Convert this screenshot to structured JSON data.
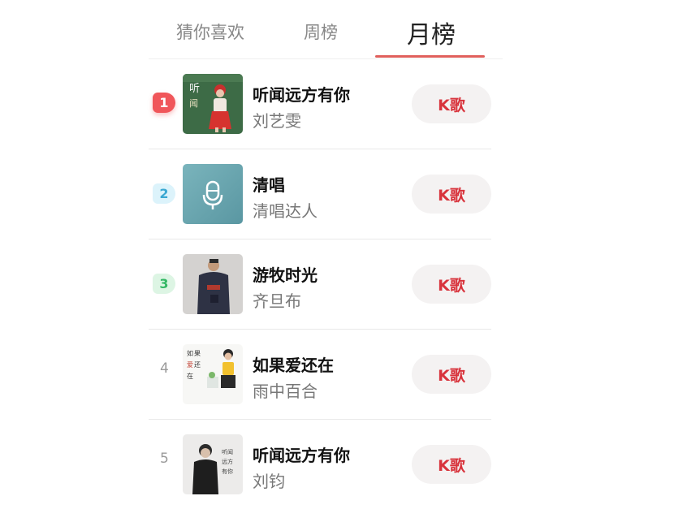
{
  "tabs": [
    {
      "label": "猜你喜欢",
      "active": false
    },
    {
      "label": "周榜",
      "active": false
    },
    {
      "label": "月榜",
      "active": true
    }
  ],
  "colors": {
    "accent": "#e0605c",
    "button_text": "#d8333c",
    "button_bg": "#f4f2f2",
    "rank1_bg": "#f0565a",
    "rank2_bg": "#dcf3fb",
    "rank2_text": "#3aa8d2",
    "rank3_bg": "#ddf5e4",
    "rank3_text": "#35b866"
  },
  "songs": [
    {
      "rank": "1",
      "title": "听闻远方有你",
      "artist": "刘艺雯",
      "button_label": "K歌",
      "cover_icon": "album-cover-green-red-dress"
    },
    {
      "rank": "2",
      "title": "清唱",
      "artist": "清唱达人",
      "button_label": "K歌",
      "cover_icon": "microphone-icon"
    },
    {
      "rank": "3",
      "title": "游牧时光",
      "artist": "齐旦布",
      "button_label": "K歌",
      "cover_icon": "album-cover-man-portrait"
    },
    {
      "rank": "4",
      "title": "如果爱还在",
      "artist": "雨中百合",
      "button_label": "K歌",
      "cover_icon": "album-cover-woman-yellow-top"
    },
    {
      "rank": "5",
      "title": "听闻远方有你",
      "artist": "刘钧",
      "button_label": "K歌",
      "cover_icon": "album-cover-man-black-white"
    }
  ]
}
